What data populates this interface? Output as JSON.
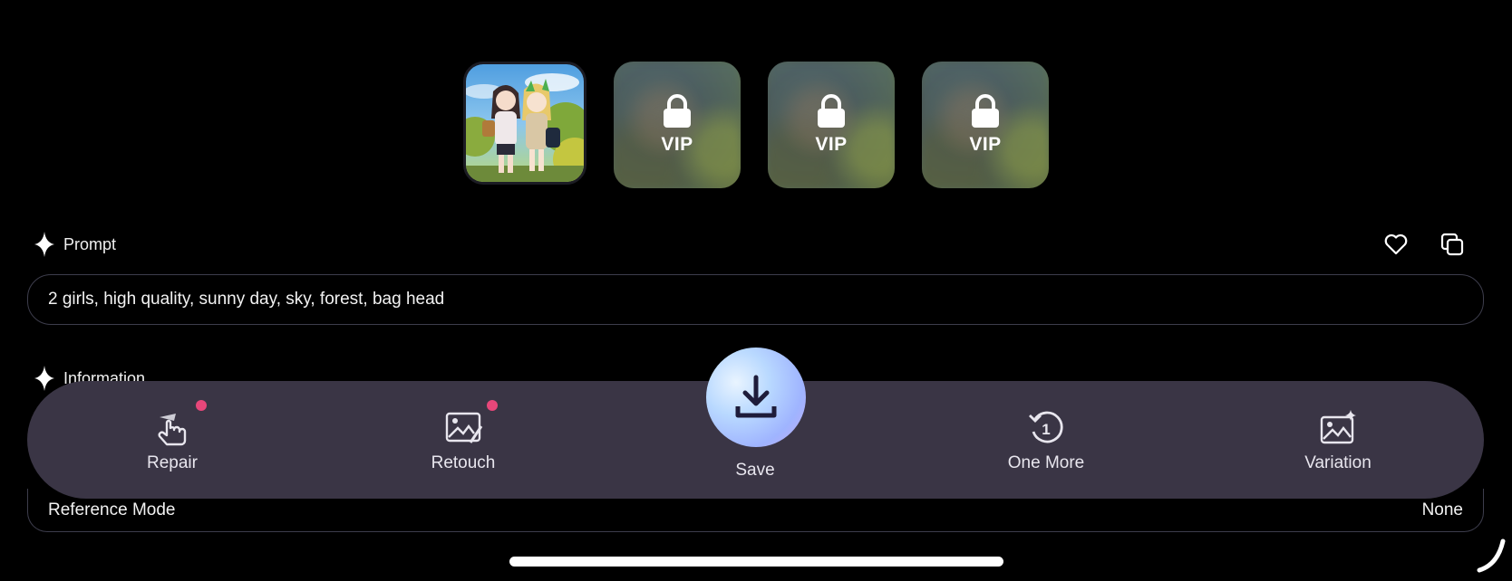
{
  "thumbnails": [
    {
      "kind": "image",
      "selected": true
    },
    {
      "kind": "locked",
      "badge": "VIP"
    },
    {
      "kind": "locked",
      "badge": "VIP"
    },
    {
      "kind": "locked",
      "badge": "VIP"
    }
  ],
  "prompt": {
    "title": "Prompt",
    "text": "2 girls, high quality, sunny day, sky, forest, bag head",
    "icons": [
      "heart-icon",
      "copy-icon"
    ]
  },
  "information": {
    "title": "Information",
    "rows": [
      {
        "label": "Reference Mode",
        "value": "None"
      }
    ]
  },
  "actions": {
    "repair": "Repair",
    "retouch": "Retouch",
    "save": "Save",
    "one_more": "One More",
    "variation": "Variation"
  },
  "colors": {
    "background": "#000000",
    "bar": "#3a3545",
    "notification_dot": "#e7477a",
    "save_gradient": [
      "#e9f4ff",
      "#9fb4ff",
      "#c6a9f5"
    ]
  }
}
